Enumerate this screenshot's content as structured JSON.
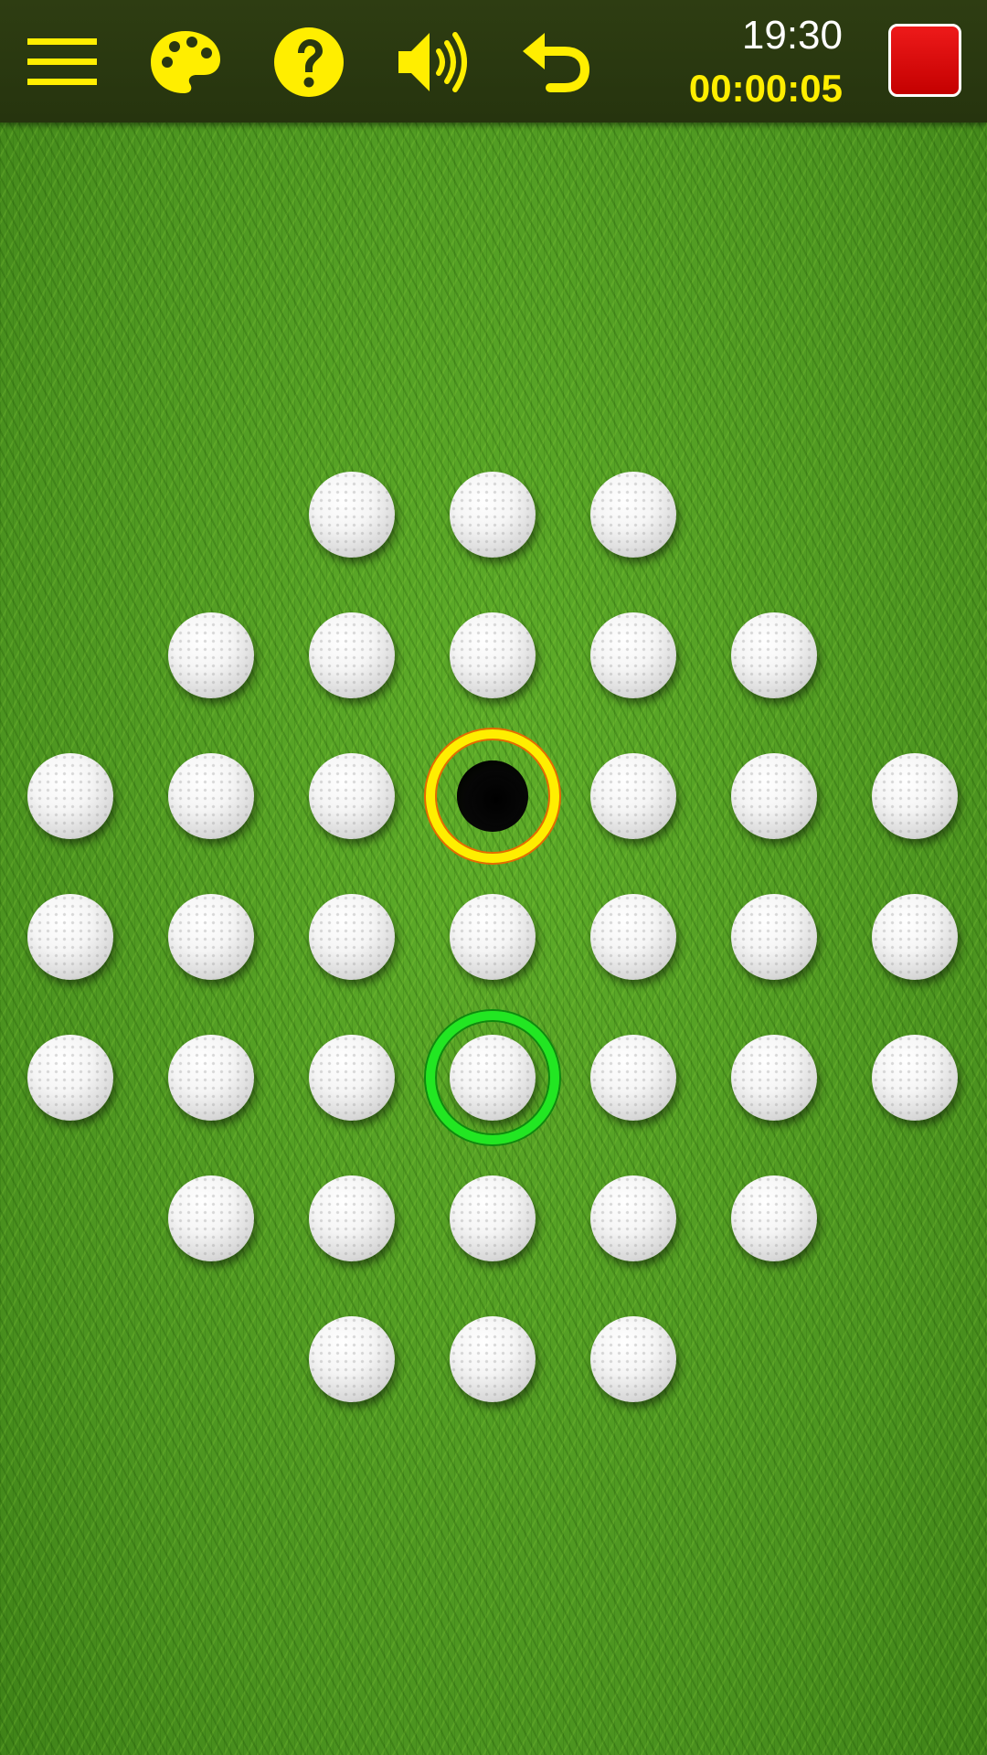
{
  "toolbar": {
    "icons": [
      "menu-icon",
      "palette-icon",
      "help-icon",
      "sound-icon",
      "undo-icon",
      "stop-icon"
    ],
    "icon_color": "#ffee00",
    "clock": "19:30",
    "timer": "00:00:05",
    "stop_color": "#dd0000"
  },
  "board": {
    "rows": [
      [
        0,
        0,
        1,
        1,
        1,
        0,
        0
      ],
      [
        0,
        1,
        1,
        1,
        1,
        1,
        0
      ],
      [
        1,
        1,
        1,
        2,
        1,
        1,
        1
      ],
      [
        1,
        1,
        1,
        1,
        1,
        1,
        1
      ],
      [
        1,
        1,
        1,
        1,
        1,
        1,
        1
      ],
      [
        0,
        1,
        1,
        1,
        1,
        1,
        0
      ],
      [
        0,
        0,
        1,
        1,
        1,
        0,
        0
      ]
    ],
    "legend": {
      "0": "off-board",
      "1": "ball",
      "2": "empty-hole"
    },
    "empty_hole": {
      "row": 2,
      "col": 3
    },
    "selected_ball": {
      "row": 4,
      "col": 3
    },
    "empty_hole_ring_color": "#ffee00",
    "selected_ring_color": "#22e622"
  }
}
